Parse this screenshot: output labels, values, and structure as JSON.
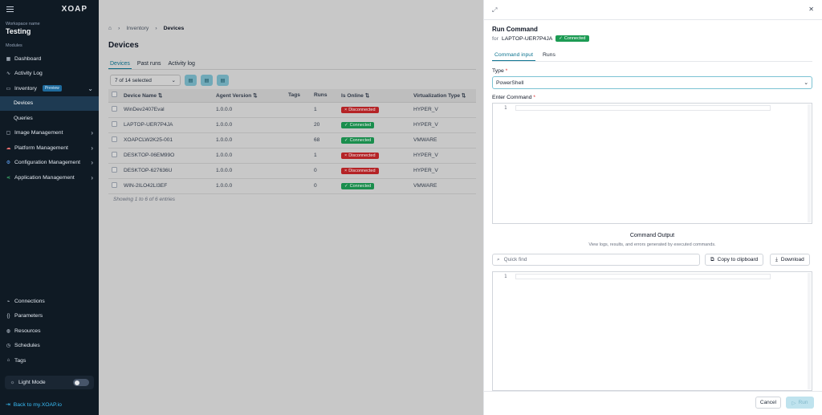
{
  "sidebar": {
    "logo": "XOAP",
    "workspace_label": "Workspace name",
    "workspace_name": "Testing",
    "modules_label": "Modules",
    "items": [
      {
        "label": "Dashboard"
      },
      {
        "label": "Activity Log"
      },
      {
        "label": "Inventory",
        "badge": "Preview"
      },
      {
        "label": "Devices"
      },
      {
        "label": "Queries"
      },
      {
        "label": "Image Management"
      },
      {
        "label": "Platform Management"
      },
      {
        "label": "Configuration Management"
      },
      {
        "label": "Application Management"
      }
    ],
    "bottom_items": [
      {
        "label": "Connections"
      },
      {
        "label": "Parameters"
      },
      {
        "label": "Resources"
      },
      {
        "label": "Schedules"
      },
      {
        "label": "Tags"
      }
    ],
    "light_mode": "Light Mode",
    "back_link": "Back to my.XOAP.io"
  },
  "main": {
    "breadcrumb": [
      "Inventory",
      "Devices"
    ],
    "title": "Devices",
    "tabs": [
      "Devices",
      "Past runs",
      "Activity log"
    ],
    "selection": "7 of 14 selected",
    "columns": [
      "Device Name",
      "Agent Version",
      "Tags",
      "Runs",
      "Is Online",
      "Virtualization Type"
    ],
    "rows": [
      {
        "name": "WinDev2407Eval",
        "version": "1.0.0.0",
        "tags": "",
        "runs": "1",
        "status": "Disconnected",
        "virt": "HYPER_V"
      },
      {
        "name": "LAPTOP-UER7P4JA",
        "version": "1.0.0.0",
        "tags": "",
        "runs": "20",
        "status": "Connected",
        "virt": "HYPER_V"
      },
      {
        "name": "XOAPCLW2K25-001",
        "version": "1.0.0.0",
        "tags": "",
        "runs": "68",
        "status": "Connected",
        "virt": "VMWARE"
      },
      {
        "name": "DESKTOP-06EM99O",
        "version": "1.0.0.0",
        "tags": "",
        "runs": "1",
        "status": "Disconnected",
        "virt": "HYPER_V"
      },
      {
        "name": "DESKTOP-627636U",
        "version": "1.0.0.0",
        "tags": "",
        "runs": "0",
        "status": "Disconnected",
        "virt": "HYPER_V"
      },
      {
        "name": "WIN-2ILO42LI3EF",
        "version": "1.0.0.0",
        "tags": "",
        "runs": "0",
        "status": "Connected",
        "virt": "VMWARE"
      }
    ],
    "showing": "Showing 1 to 6 of 6 entries"
  },
  "panel": {
    "title": "Run Command",
    "for_label": "for",
    "device": "LAPTOP-UER7P4JA",
    "device_status": "Connected",
    "tabs": [
      "Command input",
      "Runs"
    ],
    "type_label": "Type",
    "type_value": "PowerShell",
    "command_label": "Enter Command",
    "line_no": "1",
    "output_title": "Command Output",
    "output_sub": "View logs, results, and errors generated by executed commands.",
    "quick_find_placeholder": "Quick find",
    "copy_label": "Copy to clipboard",
    "download_label": "Download",
    "cancel_label": "Cancel",
    "run_label": "Run"
  },
  "colors": {
    "accent": "#0e7490",
    "connected": "#1d9b54",
    "disconnected": "#c5262a",
    "sidebar": "#0f1a24"
  }
}
